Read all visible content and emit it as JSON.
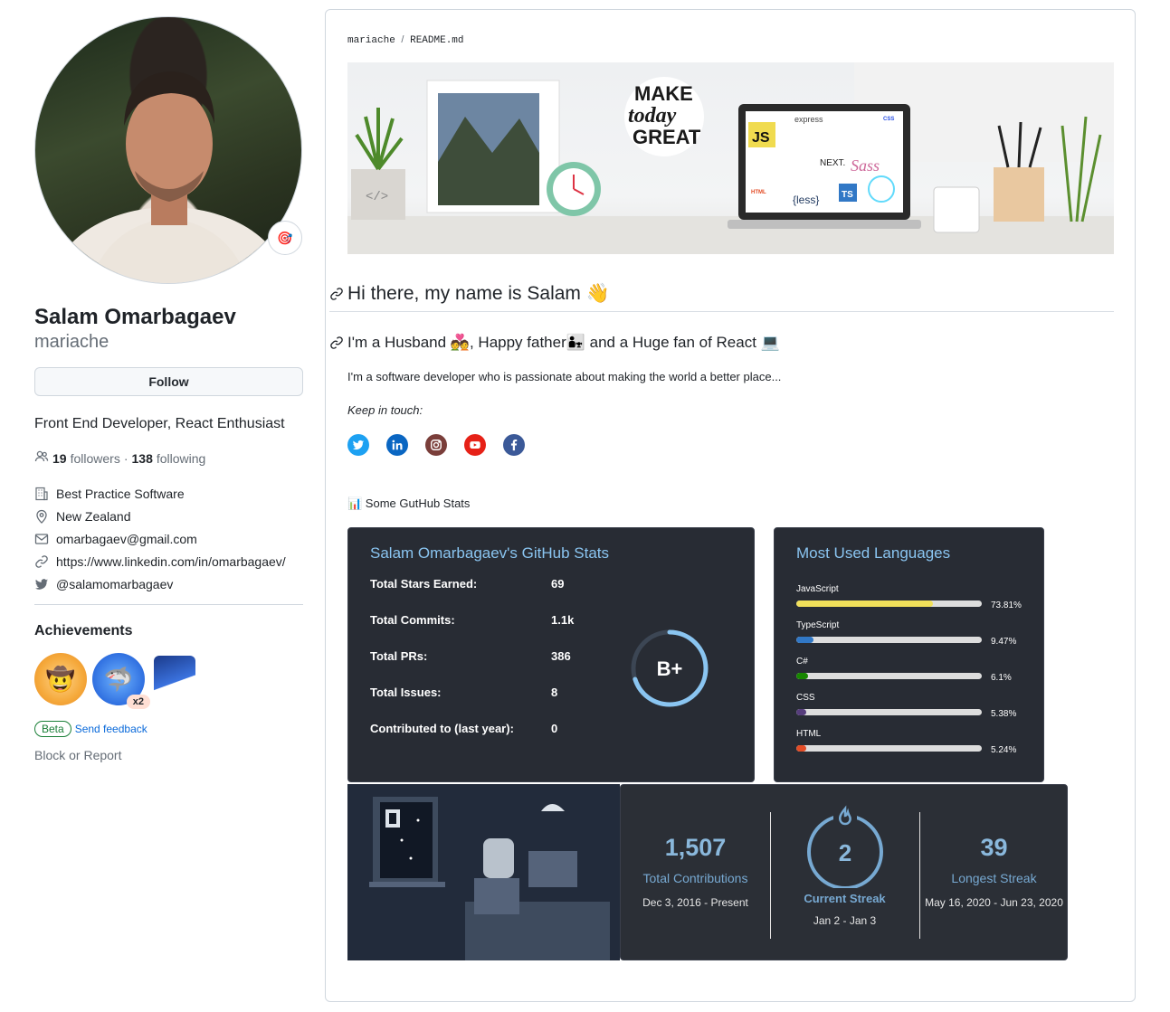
{
  "profile": {
    "fullname": "Salam Omarbagaev",
    "username": "mariache",
    "follow_label": "Follow",
    "bio": "Front End Developer, React Enthusiast",
    "followers_count": "19",
    "followers_label": "followers",
    "dot": "·",
    "following_count": "138",
    "following_label": "following",
    "company": "Best Practice Software",
    "location": "New Zealand",
    "email": "omarbagaev@gmail.com",
    "website": "https://www.linkedin.com/in/omarbagaev/",
    "twitter": "@salamomarbagaev",
    "achievements_title": "Achievements",
    "badge_multiplier": "x2",
    "beta_label": "Beta",
    "feedback_label": "Send feedback",
    "block_label": "Block or Report"
  },
  "readme": {
    "path_user": "mariache",
    "path_sep": "/",
    "path_file": "README.md",
    "banner": {
      "sticker_lines": [
        "MAKE",
        "today",
        "GREAT"
      ],
      "laptop_labels": [
        "JS",
        "express",
        "NEXT.",
        "Sass",
        "{less}",
        "TS",
        "HTML",
        "CSS"
      ]
    },
    "heading": "Hi there, my name is Salam 👋",
    "subheading": "I'm a Husband 💑, Happy father👨‍👧 and a Huge fan of React 💻",
    "intro": "I'm a software developer who is passionate about making the world a better place...",
    "keep_in_touch": "Keep in touch:",
    "socials": [
      {
        "name": "twitter",
        "color": "#1da1f2"
      },
      {
        "name": "linkedin",
        "color": "#0a66c2"
      },
      {
        "name": "instagram",
        "color": "#7a3e3a"
      },
      {
        "name": "youtube",
        "color": "#e62117"
      },
      {
        "name": "facebook",
        "color": "#3b5998"
      }
    ],
    "stats_heading": "📊 Some GutHub Stats"
  },
  "stats_card": {
    "title": "Salam Omarbagaev's GitHub Stats",
    "rows": [
      {
        "label": "Total Stars Earned:",
        "value": "69"
      },
      {
        "label": "Total Commits:",
        "value": "1.1k"
      },
      {
        "label": "Total PRs:",
        "value": "386"
      },
      {
        "label": "Total Issues:",
        "value": "8"
      },
      {
        "label": "Contributed to (last year):",
        "value": "0"
      }
    ],
    "rank": "B+",
    "rank_progress": 0.7
  },
  "languages_card": {
    "title": "Most Used Languages",
    "langs": [
      {
        "name": "JavaScript",
        "percent": 73.81,
        "label": "73.81%",
        "color": "#f1e05a"
      },
      {
        "name": "TypeScript",
        "percent": 9.47,
        "label": "9.47%",
        "color": "#3178c6"
      },
      {
        "name": "C#",
        "percent": 6.1,
        "label": "6.1%",
        "color": "#178600"
      },
      {
        "name": "CSS",
        "percent": 5.38,
        "label": "5.38%",
        "color": "#563d7c"
      },
      {
        "name": "HTML",
        "percent": 5.24,
        "label": "5.24%",
        "color": "#e34c26"
      }
    ]
  },
  "streak_card": {
    "total": "1,507",
    "total_label": "Total Contributions",
    "total_range": "Dec 3, 2016 - Present",
    "current": "2",
    "current_label": "Current Streak",
    "current_range": "Jan 2 - Jan 3",
    "longest": "39",
    "longest_label": "Longest Streak",
    "longest_range": "May 16, 2020 - Jun 23, 2020"
  }
}
